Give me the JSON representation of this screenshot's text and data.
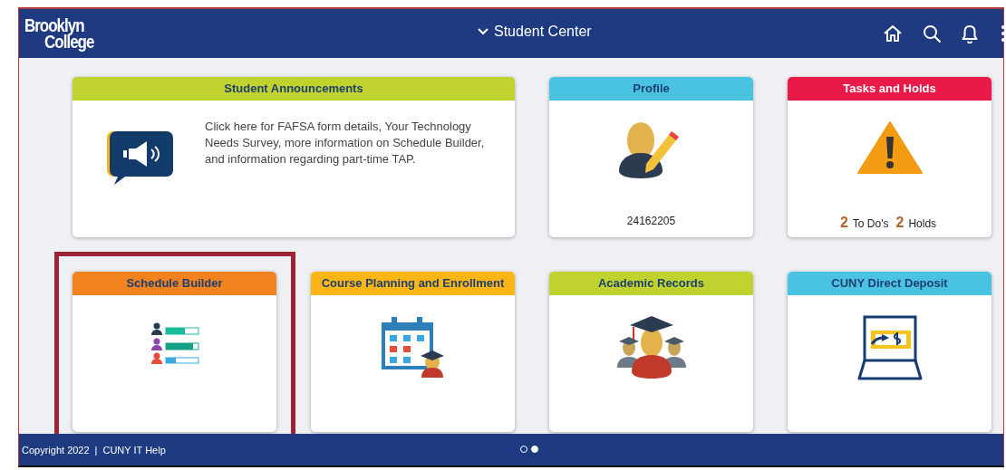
{
  "header": {
    "logo": [
      "Brooklyn",
      "College"
    ],
    "title": "Student Center"
  },
  "tiles": [
    {
      "kind": "announcements",
      "title": "Student Announcements",
      "color": "#c0d22e",
      "text": "Click here for FAFSA form details, Your Technology Needs Survey, more information on Schedule Builder, and information regarding part-time TAP.",
      "highlighted": false
    },
    {
      "kind": "profile",
      "title": "Profile",
      "color": "#4ac3e3",
      "id": "24162205",
      "highlighted": false
    },
    {
      "kind": "tasks",
      "title": "Tasks and Holds",
      "color": "#e91a48",
      "todo_count": "2",
      "todo_label": "To Do's",
      "holds_count": "2",
      "holds_label": "Holds",
      "highlighted": false
    },
    {
      "kind": "schedule",
      "title": "Schedule Builder",
      "color": "#f28220",
      "highlighted": true
    },
    {
      "kind": "planning",
      "title": "Course Planning and Enrollment",
      "color": "#fbb517",
      "highlighted": false
    },
    {
      "kind": "records",
      "title": "Academic Records",
      "color": "#c0d22e",
      "highlighted": false
    },
    {
      "kind": "deposit",
      "title": "CUNY Direct Deposit",
      "color": "#4ac3e3",
      "highlighted": false
    }
  ],
  "footer": {
    "copyright": "Copyright 2022",
    "separator": "|",
    "link": "CUNY IT Help"
  },
  "pagination": [
    {
      "selected": false
    },
    {
      "selected": true
    }
  ]
}
